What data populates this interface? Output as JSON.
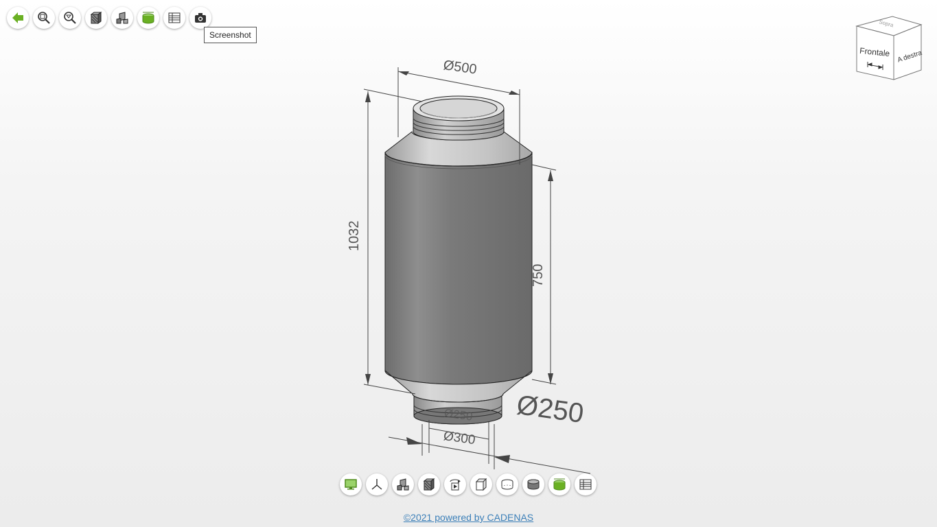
{
  "toolbar_top": [
    {
      "name": "back-button",
      "icon": "back-arrow-icon"
    },
    {
      "name": "zoom-fit-button",
      "icon": "zoom-all-icon"
    },
    {
      "name": "zoom-window-button",
      "icon": "zoom-window-icon"
    },
    {
      "name": "render-mode-button",
      "icon": "shaded-box-icon"
    },
    {
      "name": "explode-button",
      "icon": "explode-icon"
    },
    {
      "name": "dimensions-button",
      "icon": "dimension-cylinder-icon"
    },
    {
      "name": "table-button",
      "icon": "table-icon"
    },
    {
      "name": "screenshot-button",
      "icon": "camera-icon"
    }
  ],
  "tooltip": "Screenshot",
  "toolbar_bottom": [
    {
      "name": "fullscreen-button",
      "icon": "monitor-icon"
    },
    {
      "name": "axis-button",
      "icon": "axis-icon"
    },
    {
      "name": "explode-button-2",
      "icon": "explode-icon"
    },
    {
      "name": "shaded-button",
      "icon": "shaded-box-icon"
    },
    {
      "name": "rotate-button",
      "icon": "rotate-play-icon"
    },
    {
      "name": "wireframe-box-button",
      "icon": "wireframe-box-icon"
    },
    {
      "name": "hidden-lines-button",
      "icon": "cylinder-outline-icon"
    },
    {
      "name": "shaded-cylinder-button",
      "icon": "cylinder-shaded-icon"
    },
    {
      "name": "dimension-cylinder-button",
      "icon": "dimension-cylinder-icon"
    },
    {
      "name": "table-button-2",
      "icon": "table-icon"
    }
  ],
  "viewcube": {
    "top": "Sopra",
    "front": "Frontale",
    "right": "A destra"
  },
  "dimensions": {
    "top_diameter": "Ø500",
    "total_height": "1032",
    "body_height": "750",
    "outlet_diameter_large": "Ø250",
    "outlet_diameter_small": "Ø250",
    "flange_diameter": "Ø300"
  },
  "colors": {
    "accent_green": "#6ab023",
    "body_gray": "#808080",
    "link": "#3b7fb8"
  },
  "footer": {
    "link_text": "©2021 powered by CADENAS"
  }
}
